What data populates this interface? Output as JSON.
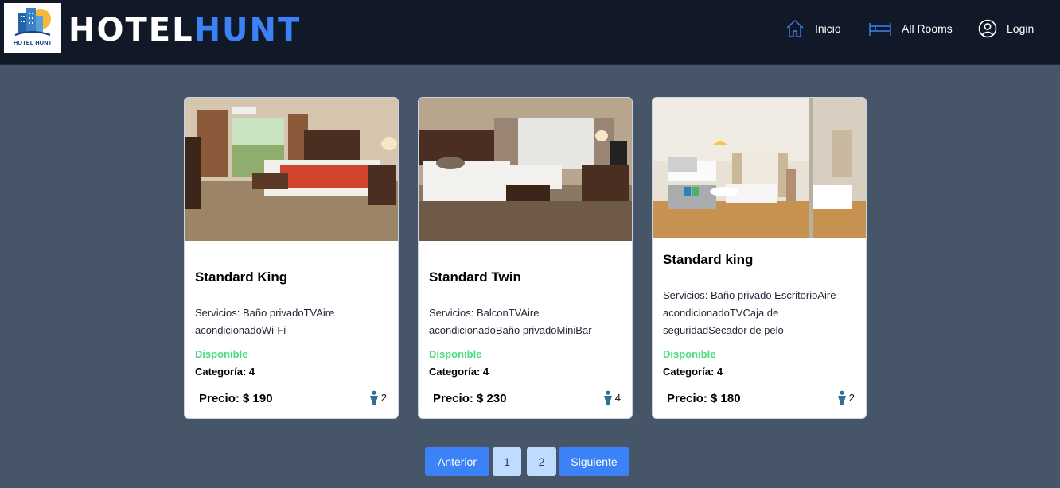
{
  "header": {
    "logo_text": "HOTEL HUNT",
    "brand_part1": "HOTEL",
    "brand_part2": "HUNT",
    "nav": [
      {
        "label": "Inicio",
        "icon": "home-icon"
      },
      {
        "label": "All Rooms",
        "icon": "bed-icon"
      },
      {
        "label": "Login",
        "icon": "user-circle-icon"
      }
    ]
  },
  "rooms": [
    {
      "name": "Standard King",
      "services": "Servicios: Baño privadoTVAire acondicionadoWi-Fi",
      "status": "Disponible",
      "category": "Categoría: 4",
      "price": "Precio: $ 190",
      "guests": "2"
    },
    {
      "name": "Standard Twin",
      "services": "Servicios: BalconTVAire acondicionadoBaño privadoMiniBar",
      "status": "Disponible",
      "category": "Categoría: 4",
      "price": "Precio: $ 230",
      "guests": "4"
    },
    {
      "name": "Standard king",
      "services": "Servicios: Baño privado EscritorioAire acondicionadoTVCaja de seguridadSecador de pelo",
      "status": "Disponible",
      "category": "Categoría: 4",
      "price": "Precio: $ 180",
      "guests": "2"
    }
  ],
  "pagination": {
    "prev": "Anterior",
    "pages": [
      "1",
      "2"
    ],
    "next": "Siguiente"
  },
  "colors": {
    "background": "#475569",
    "navbar": "#111827",
    "accent": "#3b82f6",
    "available": "#4ade80"
  }
}
